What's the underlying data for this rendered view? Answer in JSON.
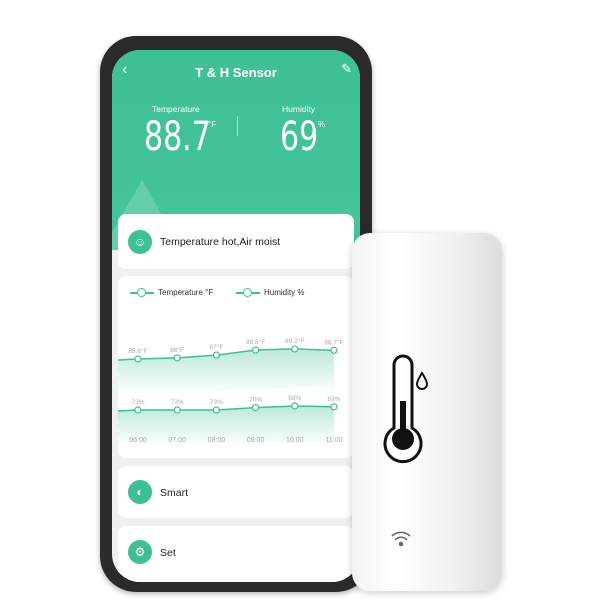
{
  "app": {
    "title": "T & H Sensor",
    "back_icon": "chevron-left-icon",
    "edit_icon": "pencil-icon"
  },
  "readings": {
    "temperature_label": "Temperature",
    "temperature_value": "88.7",
    "temperature_unit": "°F",
    "humidity_label": "Humidity",
    "humidity_value": "69",
    "humidity_unit": "%"
  },
  "status": {
    "text": "Temperature hot,Air moist",
    "icon": "face-icon"
  },
  "chart_data": {
    "type": "line",
    "x": [
      "06:00",
      "07:00",
      "08:00",
      "09:00",
      "10:00",
      "11:00"
    ],
    "series": [
      {
        "name": "Temperature °F",
        "values": [
          85.6,
          86,
          87,
          88.8,
          89.2,
          88.7
        ],
        "labels": [
          "85.6°F",
          "86°F",
          "87°F",
          "88.8°F",
          "89.2°F",
          "88.7°F"
        ]
      },
      {
        "name": "Humidity %",
        "values": [
          73,
          73,
          73,
          70,
          68,
          69
        ],
        "labels": [
          "73%",
          "73%",
          "73%",
          "70%",
          "68%",
          "69%"
        ]
      }
    ],
    "legend": "top-left",
    "color": "#3fbf95"
  },
  "menu": [
    {
      "label": "Smart",
      "icon": "toggle-icon"
    },
    {
      "label": "Set",
      "icon": "gear-icon"
    }
  ],
  "colors": {
    "accent": "#3fbf95"
  }
}
